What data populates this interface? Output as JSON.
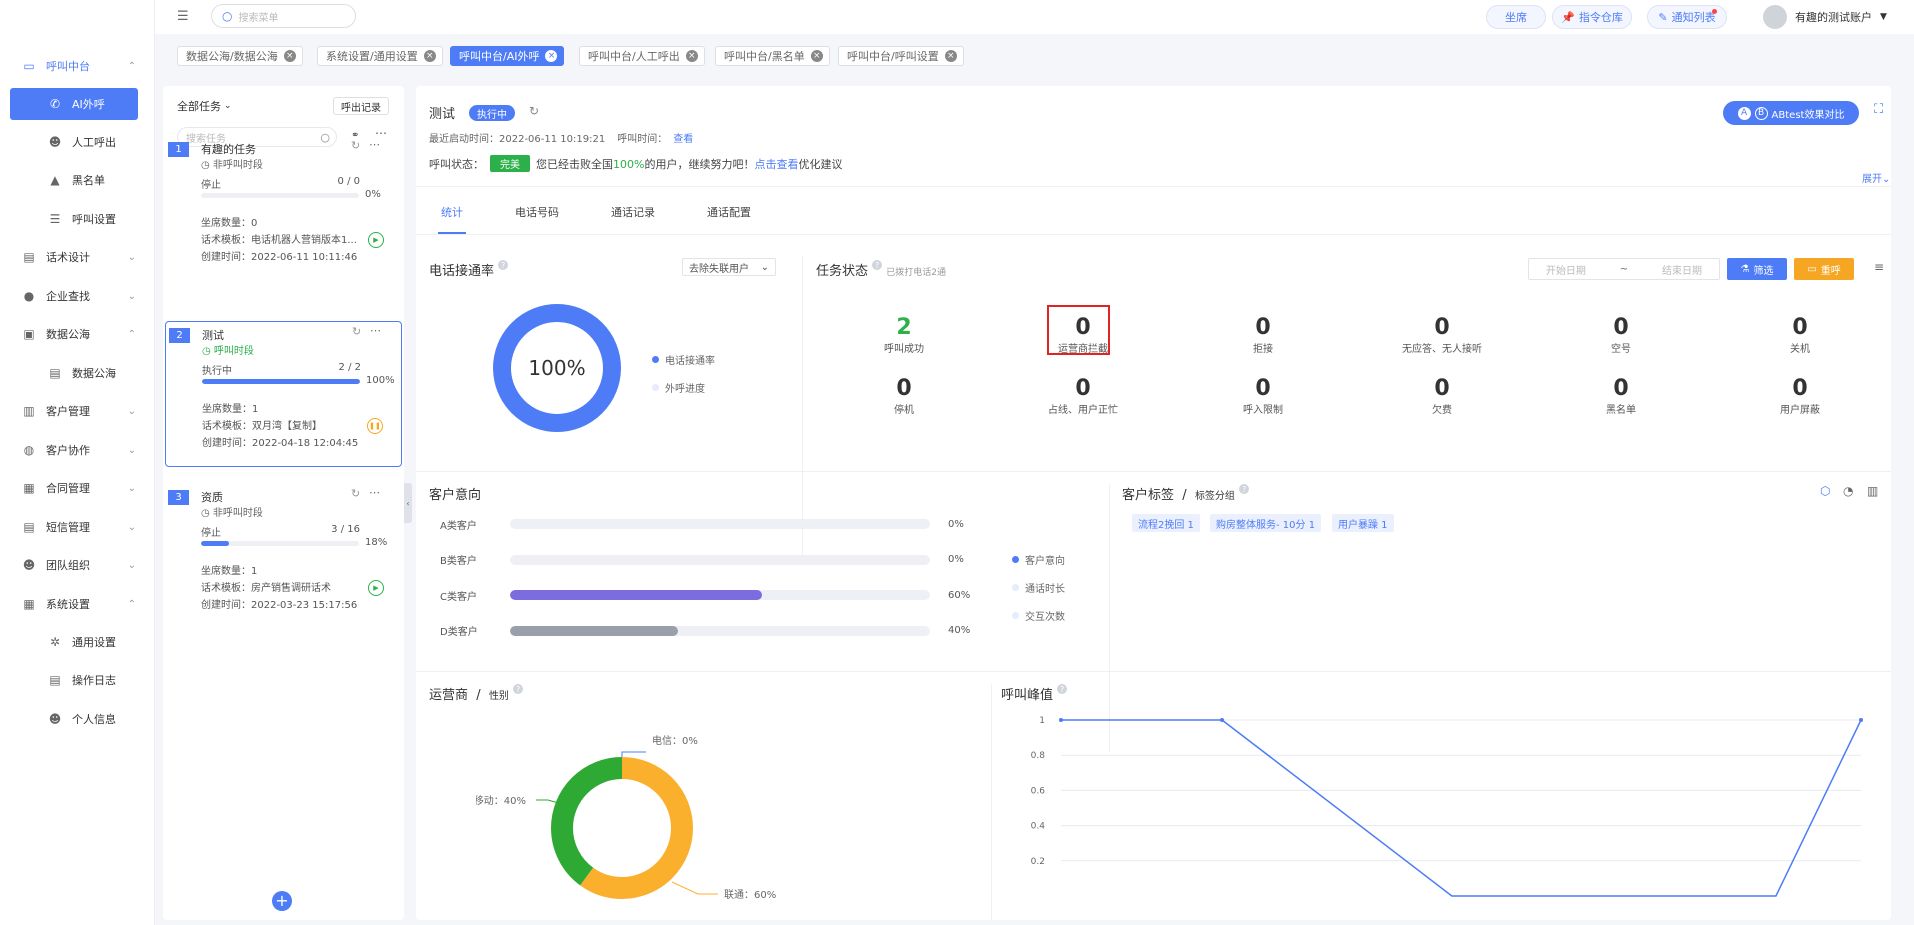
{
  "colors": {
    "primary": "#4e7cf6",
    "green": "#2bb04a",
    "orange": "#f5a623",
    "purple": "#7b6ce0",
    "gray": "#9aa0ab"
  },
  "sidebar": {
    "items": [
      {
        "label": "呼叫中台",
        "icon": "monitor-icon",
        "chevron": "⌃"
      },
      {
        "label": "AI外呼",
        "icon": "phone-icon"
      },
      {
        "label": "人工呼出",
        "icon": "user-icon"
      },
      {
        "label": "黑名单",
        "icon": "warning-icon"
      },
      {
        "label": "呼叫设置",
        "icon": "sliders-icon"
      },
      {
        "label": "话术设计",
        "icon": "book-icon",
        "chevron": "⌄"
      },
      {
        "label": "企业查找",
        "icon": "bulb-icon",
        "chevron": "⌄"
      },
      {
        "label": "数据公海",
        "icon": "chart-icon",
        "chevron": "⌃"
      },
      {
        "label": "数据公海",
        "icon": "table-icon"
      },
      {
        "label": "客户管理",
        "icon": "contacts-icon",
        "chevron": "⌄"
      },
      {
        "label": "客户协作",
        "icon": "globe-icon",
        "chevron": "⌄"
      },
      {
        "label": "合同管理",
        "icon": "clipboard-icon",
        "chevron": "⌄"
      },
      {
        "label": "短信管理",
        "icon": "sms-icon",
        "chevron": "⌄"
      },
      {
        "label": "团队组织",
        "icon": "team-icon",
        "chevron": "⌄"
      },
      {
        "label": "系统设置",
        "icon": "dashboard-icon",
        "chevron": "⌃"
      },
      {
        "label": "通用设置",
        "icon": "gear-icon"
      },
      {
        "label": "操作日志",
        "icon": "log-icon"
      },
      {
        "label": "个人信息",
        "icon": "person-icon"
      }
    ]
  },
  "header": {
    "search_placeholder": "搜索菜单",
    "btn_seat": "坐席",
    "btn_commands": "指令仓库",
    "btn_notify": "通知列表",
    "account": "有趣的测试账户"
  },
  "tabs": [
    {
      "label": "数据公海/数据公海"
    },
    {
      "label": "系统设置/通用设置"
    },
    {
      "label": "呼叫中台/AI外呼"
    },
    {
      "label": "呼叫中台/人工呼出"
    },
    {
      "label": "呼叫中台/黑名单"
    },
    {
      "label": "呼叫中台/呼叫设置"
    }
  ],
  "task_panel": {
    "filter_label": "全部任务",
    "export_btn": "呼出记录",
    "search_placeholder": "搜索任务",
    "tasks": [
      {
        "num": "1",
        "name": "有趣的任务",
        "period": "非呼叫时段",
        "status": "停止",
        "progress_text": "0 / 0",
        "percent": "0%",
        "progress": 0,
        "seats": "坐席数量：0",
        "template": "话术模板：电话机器人营销版本1...",
        "created": "创建时间：2022-06-11 10:11:46"
      },
      {
        "num": "2",
        "name": "测试",
        "period": "呼叫时段",
        "status": "执行中",
        "progress_text": "2 / 2",
        "percent": "100%",
        "progress": 1.0,
        "seats": "坐席数量：1",
        "template": "话术模板：双月湾【复制】",
        "created": "创建时间：2022-04-18 12:04:45"
      },
      {
        "num": "3",
        "name": "资质",
        "period": "非呼叫时段",
        "status": "停止",
        "progress_text": "3 / 16",
        "percent": "18%",
        "progress": 0.18,
        "seats": "坐席数量：1",
        "template": "话术模板：房产销售调研话术",
        "created": "创建时间：2022-03-23 15:17:56"
      }
    ]
  },
  "detail": {
    "title": "测试",
    "status_badge": "执行中",
    "last_start": "最近启动时间：2022-06-11 10:19:21",
    "call_time_label": "呼叫时间：",
    "call_time_link": "查看",
    "call_status_label": "呼叫状态：",
    "call_status_badge": "完美",
    "call_status_text_1": "您已经击败全国",
    "call_status_pct": "100%",
    "call_status_text_2": "的用户，继续努力吧！",
    "call_status_link": "点击查看",
    "call_status_text_3": "优化建议",
    "abtest_btn": "ABtest效果对比",
    "expand": "展开",
    "tabs": [
      "统计",
      "电话号码",
      "通话记录",
      "通话配置"
    ]
  },
  "connect_rate": {
    "title": "电话接通率",
    "filter": "去除失联用户",
    "center_text": "100%",
    "value": 1.0,
    "legend": [
      "电话接通率",
      "外呼进度"
    ]
  },
  "task_status": {
    "title": "任务状态",
    "note": "已拨打电话2通",
    "start_date_placeholder": "开始日期",
    "date_sep": "~",
    "end_date_placeholder": "结束日期",
    "filter_btn": "筛选",
    "reset_btn": "重呼",
    "stats": [
      {
        "value": "2",
        "label": "呼叫成功"
      },
      {
        "value": "0",
        "label": "运营商拦截"
      },
      {
        "value": "0",
        "label": "拒接"
      },
      {
        "value": "0",
        "label": "无应答、无人接听"
      },
      {
        "value": "0",
        "label": "空号"
      },
      {
        "value": "0",
        "label": "关机"
      },
      {
        "value": "0",
        "label": "停机"
      },
      {
        "value": "0",
        "label": "占线、用户正忙"
      },
      {
        "value": "0",
        "label": "呼入限制"
      },
      {
        "value": "0",
        "label": "欠费"
      },
      {
        "value": "0",
        "label": "黑名单"
      },
      {
        "value": "0",
        "label": "用户屏蔽"
      }
    ]
  },
  "intention": {
    "title": "客户意向",
    "rows": [
      {
        "label": "A类客户",
        "pct": "0%",
        "value": 0.0
      },
      {
        "label": "B类客户",
        "pct": "0%",
        "value": 0.0
      },
      {
        "label": "C类客户",
        "pct": "60%",
        "value": 0.6
      },
      {
        "label": "D类客户",
        "pct": "40%",
        "value": 0.4
      }
    ],
    "legend": [
      "客户意向",
      "通话时长",
      "交互次数"
    ]
  },
  "tags": {
    "title": "客户标签",
    "sep": "/",
    "subtitle": "标签分组",
    "chips": [
      "流程2挽回 1",
      "购房整体服务- 10分 1",
      "用户暴躁 1"
    ]
  },
  "operator": {
    "title": "运营商",
    "sep": "/",
    "subtitle": "性别",
    "slices": [
      {
        "label": "电信：0%",
        "value": 0
      },
      {
        "label": "联通：60%",
        "value": 60
      },
      {
        "label": "移动：40%",
        "value": 40
      }
    ]
  },
  "peak": {
    "title": "呼叫峰值"
  },
  "chart_data": {
    "type": "line",
    "title": "呼叫峰值",
    "y_ticks": [
      "1",
      "0.8",
      "0.6",
      "0.4",
      "0.2"
    ],
    "ylim": [
      0,
      1
    ],
    "x": [
      0,
      1,
      2,
      3,
      4,
      5
    ],
    "values": [
      1,
      1,
      0,
      0,
      0,
      1
    ],
    "grid": true
  }
}
